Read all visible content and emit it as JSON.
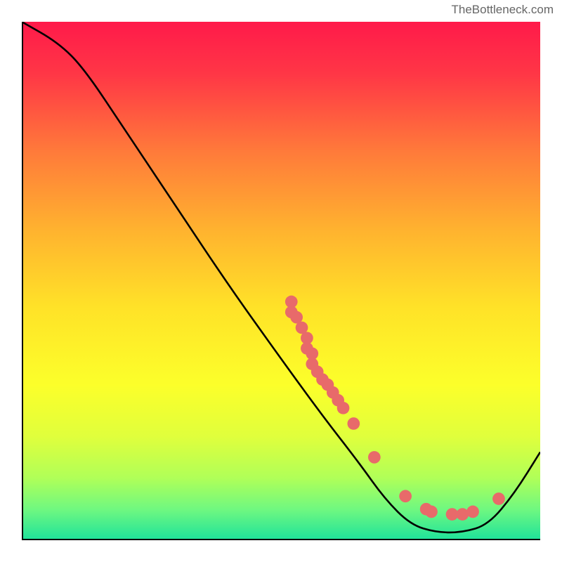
{
  "watermark": "TheBottleneck.com",
  "chart_data": {
    "type": "line",
    "title": "",
    "xlabel": "",
    "ylabel": "",
    "xlim": [
      0,
      100
    ],
    "ylim": [
      0,
      100
    ],
    "curve": [
      {
        "x": 0,
        "y": 100
      },
      {
        "x": 7,
        "y": 96
      },
      {
        "x": 12,
        "y": 91
      },
      {
        "x": 20,
        "y": 79
      },
      {
        "x": 30,
        "y": 64
      },
      {
        "x": 40,
        "y": 49
      },
      {
        "x": 50,
        "y": 35
      },
      {
        "x": 58,
        "y": 24
      },
      {
        "x": 65,
        "y": 15
      },
      {
        "x": 70,
        "y": 8
      },
      {
        "x": 75,
        "y": 3
      },
      {
        "x": 80,
        "y": 1.5
      },
      {
        "x": 85,
        "y": 1.5
      },
      {
        "x": 90,
        "y": 3
      },
      {
        "x": 95,
        "y": 9
      },
      {
        "x": 100,
        "y": 17
      }
    ],
    "points": [
      {
        "x": 52,
        "y": 46
      },
      {
        "x": 52,
        "y": 44
      },
      {
        "x": 53,
        "y": 43
      },
      {
        "x": 54,
        "y": 41
      },
      {
        "x": 55,
        "y": 39
      },
      {
        "x": 55,
        "y": 37
      },
      {
        "x": 56,
        "y": 36
      },
      {
        "x": 56,
        "y": 34
      },
      {
        "x": 57,
        "y": 32.5
      },
      {
        "x": 58,
        "y": 31
      },
      {
        "x": 59,
        "y": 30
      },
      {
        "x": 60,
        "y": 28.5
      },
      {
        "x": 61,
        "y": 27
      },
      {
        "x": 62,
        "y": 25.5
      },
      {
        "x": 64,
        "y": 22.5
      },
      {
        "x": 68,
        "y": 16
      },
      {
        "x": 74,
        "y": 8.5
      },
      {
        "x": 78,
        "y": 6
      },
      {
        "x": 79,
        "y": 5.5
      },
      {
        "x": 83,
        "y": 5
      },
      {
        "x": 85,
        "y": 5
      },
      {
        "x": 87,
        "y": 5.5
      },
      {
        "x": 92,
        "y": 8
      }
    ],
    "gradient_stops": [
      {
        "offset": 0,
        "color": "#ff1a4a"
      },
      {
        "offset": 0.1,
        "color": "#ff3646"
      },
      {
        "offset": 0.25,
        "color": "#ff7a3a"
      },
      {
        "offset": 0.4,
        "color": "#ffb22f"
      },
      {
        "offset": 0.55,
        "color": "#ffe228"
      },
      {
        "offset": 0.7,
        "color": "#fcff2a"
      },
      {
        "offset": 0.8,
        "color": "#e0ff3c"
      },
      {
        "offset": 0.88,
        "color": "#b0ff58"
      },
      {
        "offset": 0.94,
        "color": "#70f880"
      },
      {
        "offset": 1.0,
        "color": "#1de29b"
      }
    ],
    "colors": {
      "curve": "#000000",
      "point_fill": "#e86a6a",
      "point_stroke": "#e86a6a"
    }
  }
}
